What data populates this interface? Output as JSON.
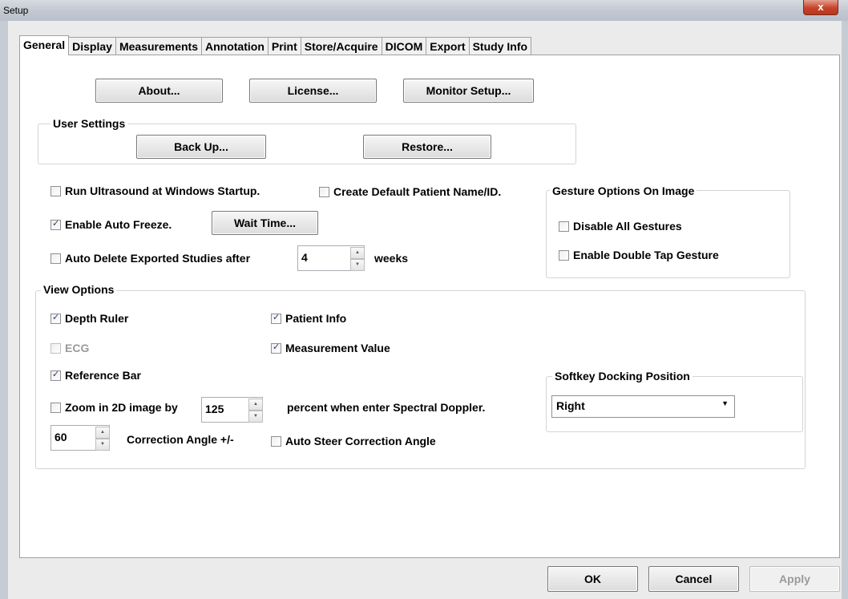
{
  "window": {
    "title": "Setup",
    "close": "x"
  },
  "tabs": [
    "General",
    "Display",
    "Measurements",
    "Annotation",
    "Print",
    "Store/Acquire",
    "DICOM",
    "Export",
    "Study Info"
  ],
  "top_buttons": {
    "about": "About...",
    "license": "License...",
    "monitor": "Monitor Setup..."
  },
  "user_settings": {
    "title": "User Settings",
    "backup": "Back Up...",
    "restore": "Restore..."
  },
  "options": {
    "run_startup": "Run Ultrasound at Windows Startup.",
    "default_patient": "Create Default Patient Name/ID.",
    "auto_freeze": "Enable Auto Freeze.",
    "wait_time": "Wait Time...",
    "auto_delete": "Auto Delete Exported Studies after",
    "auto_delete_value": "4",
    "weeks": "weeks"
  },
  "gesture": {
    "title": "Gesture Options On Image",
    "disable_all": "Disable All Gestures",
    "double_tap": "Enable Double Tap Gesture"
  },
  "view": {
    "title": "View Options",
    "depth_ruler": "Depth Ruler",
    "patient_info": "Patient Info",
    "ecg": "ECG",
    "measurement_value": "Measurement Value",
    "reference_bar": "Reference Bar",
    "zoom_label": "Zoom in 2D image by",
    "zoom_value": "125",
    "zoom_suffix": "percent when enter Spectral Doppler.",
    "angle_value": "60",
    "angle_label": "Correction Angle +/-",
    "auto_steer": "Auto Steer Correction Angle"
  },
  "softkey": {
    "title": "Softkey Docking Position",
    "value": "Right"
  },
  "footer": {
    "ok": "OK",
    "cancel": "Cancel",
    "apply": "Apply"
  }
}
